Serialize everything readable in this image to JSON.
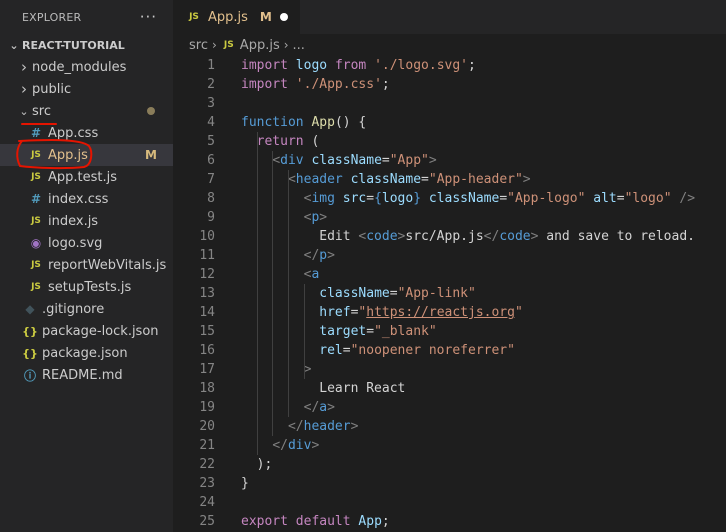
{
  "sidebar": {
    "header_title": "EXPLORER",
    "more_glyph": "···",
    "project_name": "REACT-TUTORIAL",
    "items": [
      {
        "label": "node_modules",
        "kind": "folder",
        "expanded": false,
        "badge": ""
      },
      {
        "label": "public",
        "kind": "folder",
        "expanded": false,
        "badge": ""
      },
      {
        "label": "src",
        "kind": "folder",
        "expanded": true,
        "badge": "dot"
      },
      {
        "label": "App.css",
        "kind": "css",
        "badge": ""
      },
      {
        "label": "App.js",
        "kind": "js",
        "badge": "M",
        "selected": true
      },
      {
        "label": "App.test.js",
        "kind": "js",
        "badge": ""
      },
      {
        "label": "index.css",
        "kind": "css",
        "badge": ""
      },
      {
        "label": "index.js",
        "kind": "js",
        "badge": ""
      },
      {
        "label": "logo.svg",
        "kind": "svg",
        "badge": ""
      },
      {
        "label": "reportWebVitals.js",
        "kind": "js",
        "badge": ""
      },
      {
        "label": "setupTests.js",
        "kind": "js",
        "badge": ""
      },
      {
        "label": ".gitignore",
        "kind": "git",
        "badge": ""
      },
      {
        "label": "package-lock.json",
        "kind": "json",
        "badge": ""
      },
      {
        "label": "package.json",
        "kind": "json",
        "badge": ""
      },
      {
        "label": "README.md",
        "kind": "info",
        "badge": ""
      }
    ]
  },
  "tab": {
    "icon": "JS",
    "label": "App.js",
    "modified": "M"
  },
  "breadcrumb": {
    "folder": "src",
    "file": "App.js",
    "ellipsis": "..."
  },
  "code_lines": [
    [
      [
        "kw",
        "import"
      ],
      [
        "plain",
        " "
      ],
      [
        "var",
        "logo"
      ],
      [
        "plain",
        " "
      ],
      [
        "kw",
        "from"
      ],
      [
        "plain",
        " "
      ],
      [
        "str",
        "'./logo.svg'"
      ],
      [
        "plain",
        ";"
      ]
    ],
    [
      [
        "kw",
        "import"
      ],
      [
        "plain",
        " "
      ],
      [
        "str",
        "'./App.css'"
      ],
      [
        "plain",
        ";"
      ]
    ],
    [],
    [
      [
        "kb",
        "function"
      ],
      [
        "plain",
        " "
      ],
      [
        "fn",
        "App"
      ],
      [
        "plain",
        "() {"
      ]
    ],
    [
      [
        "plain",
        "  "
      ],
      [
        "kw",
        "return"
      ],
      [
        "plain",
        " ("
      ]
    ],
    [
      [
        "plain",
        "    "
      ],
      [
        "ang",
        "<"
      ],
      [
        "tag",
        "div"
      ],
      [
        "plain",
        " "
      ],
      [
        "attr",
        "className"
      ],
      [
        "plain",
        "="
      ],
      [
        "str",
        "\"App\""
      ],
      [
        "ang",
        ">"
      ]
    ],
    [
      [
        "plain",
        "      "
      ],
      [
        "ang",
        "<"
      ],
      [
        "tag",
        "header"
      ],
      [
        "plain",
        " "
      ],
      [
        "attr",
        "className"
      ],
      [
        "plain",
        "="
      ],
      [
        "str",
        "\"App-header\""
      ],
      [
        "ang",
        ">"
      ]
    ],
    [
      [
        "plain",
        "        "
      ],
      [
        "ang",
        "<"
      ],
      [
        "tag",
        "img"
      ],
      [
        "plain",
        " "
      ],
      [
        "attr",
        "src"
      ],
      [
        "plain",
        "="
      ],
      [
        "kb",
        "{"
      ],
      [
        "var",
        "logo"
      ],
      [
        "kb",
        "}"
      ],
      [
        "plain",
        " "
      ],
      [
        "attr",
        "className"
      ],
      [
        "plain",
        "="
      ],
      [
        "str",
        "\"App-logo\""
      ],
      [
        "plain",
        " "
      ],
      [
        "attr",
        "alt"
      ],
      [
        "plain",
        "="
      ],
      [
        "str",
        "\"logo\""
      ],
      [
        "plain",
        " "
      ],
      [
        "ang",
        "/>"
      ]
    ],
    [
      [
        "plain",
        "        "
      ],
      [
        "ang",
        "<"
      ],
      [
        "tag",
        "p"
      ],
      [
        "ang",
        ">"
      ]
    ],
    [
      [
        "plain",
        "          Edit "
      ],
      [
        "ang",
        "<"
      ],
      [
        "tag",
        "code"
      ],
      [
        "ang",
        ">"
      ],
      [
        "plain",
        "src/App.js"
      ],
      [
        "ang",
        "</"
      ],
      [
        "tag",
        "code"
      ],
      [
        "ang",
        ">"
      ],
      [
        "plain",
        " and save to reload."
      ]
    ],
    [
      [
        "plain",
        "        "
      ],
      [
        "ang",
        "</"
      ],
      [
        "tag",
        "p"
      ],
      [
        "ang",
        ">"
      ]
    ],
    [
      [
        "plain",
        "        "
      ],
      [
        "ang",
        "<"
      ],
      [
        "tag",
        "a"
      ]
    ],
    [
      [
        "plain",
        "          "
      ],
      [
        "attr",
        "className"
      ],
      [
        "plain",
        "="
      ],
      [
        "str",
        "\"App-link\""
      ]
    ],
    [
      [
        "plain",
        "          "
      ],
      [
        "attr",
        "href"
      ],
      [
        "plain",
        "="
      ],
      [
        "str",
        "\""
      ],
      [
        "link",
        "https://reactjs.org"
      ],
      [
        "str",
        "\""
      ]
    ],
    [
      [
        "plain",
        "          "
      ],
      [
        "attr",
        "target"
      ],
      [
        "plain",
        "="
      ],
      [
        "str",
        "\"_blank\""
      ]
    ],
    [
      [
        "plain",
        "          "
      ],
      [
        "attr",
        "rel"
      ],
      [
        "plain",
        "="
      ],
      [
        "str",
        "\"noopener noreferrer\""
      ]
    ],
    [
      [
        "plain",
        "        "
      ],
      [
        "ang",
        ">"
      ]
    ],
    [
      [
        "plain",
        "          Learn React"
      ]
    ],
    [
      [
        "plain",
        "        "
      ],
      [
        "ang",
        "</"
      ],
      [
        "tag",
        "a"
      ],
      [
        "ang",
        ">"
      ]
    ],
    [
      [
        "plain",
        "      "
      ],
      [
        "ang",
        "</"
      ],
      [
        "tag",
        "header"
      ],
      [
        "ang",
        ">"
      ]
    ],
    [
      [
        "plain",
        "    "
      ],
      [
        "ang",
        "</"
      ],
      [
        "tag",
        "div"
      ],
      [
        "ang",
        ">"
      ]
    ],
    [
      [
        "plain",
        "  );"
      ]
    ],
    [
      [
        "plain",
        "}"
      ]
    ],
    [],
    [
      [
        "kw",
        "export"
      ],
      [
        "plain",
        " "
      ],
      [
        "kw",
        "default"
      ],
      [
        "plain",
        " "
      ],
      [
        "var",
        "App"
      ],
      [
        "plain",
        ";"
      ]
    ]
  ],
  "colors": {
    "accent_modified": "#e2c08d",
    "annotation_red": "#e51400"
  }
}
